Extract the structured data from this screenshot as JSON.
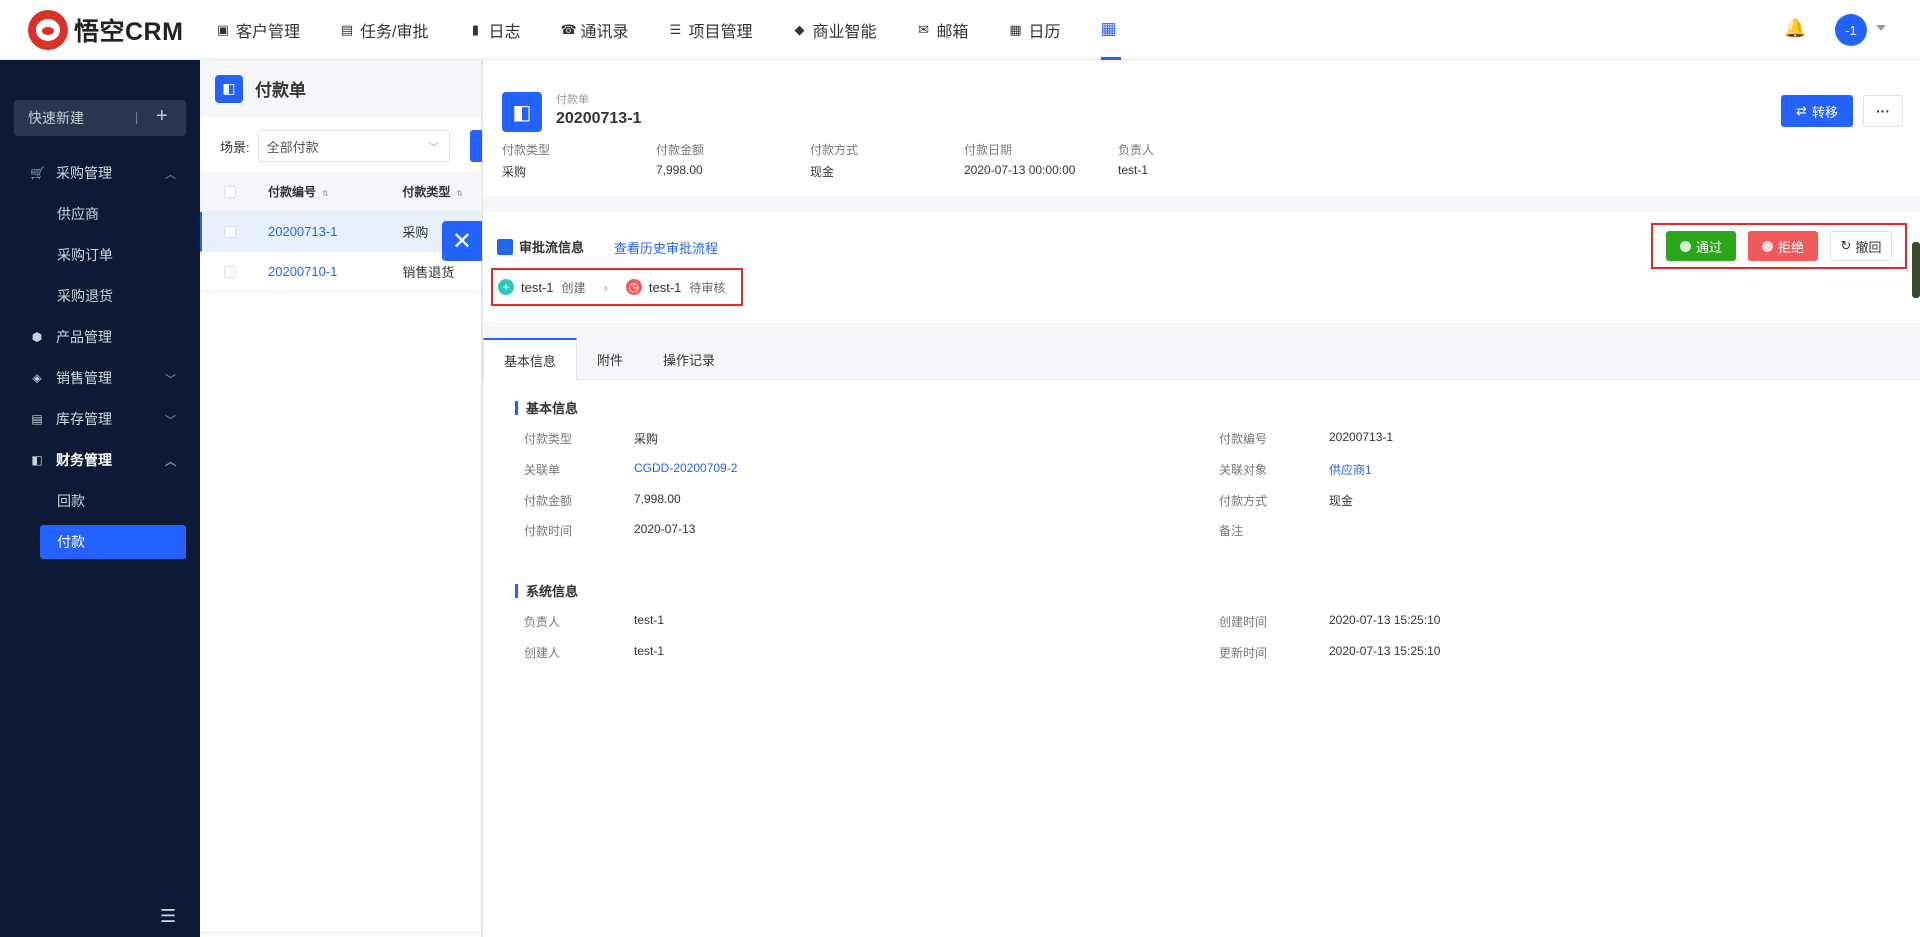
{
  "app": {
    "logo_text": "悟空CRM"
  },
  "nav": {
    "items": [
      {
        "icon": "person-card-icon",
        "glyph": "▣",
        "label": "客户管理"
      },
      {
        "icon": "briefcase-icon",
        "glyph": "▤",
        "label": "任务/审批"
      },
      {
        "icon": "journal-icon",
        "glyph": "▮",
        "label": "日志"
      },
      {
        "icon": "phone-icon",
        "glyph": "☎",
        "label": "通讯录"
      },
      {
        "icon": "list-icon",
        "glyph": "☰",
        "label": "项目管理"
      },
      {
        "icon": "shield-icon",
        "glyph": "◆",
        "label": "商业智能"
      },
      {
        "icon": "mail-icon",
        "glyph": "✉",
        "label": "邮箱"
      },
      {
        "icon": "calendar-icon",
        "glyph": "▦",
        "label": "日历"
      }
    ],
    "apps_glyph": "⋮⋮⋮",
    "avatar_text": "-1"
  },
  "sidebar": {
    "quick_new": "快速新建",
    "quick_new_plus": "+",
    "menu": {
      "purchase": {
        "label": "采购管理",
        "chevron": "^",
        "sub": [
          "供应商",
          "采购订单",
          "采购退货"
        ]
      },
      "product": {
        "label": "产品管理"
      },
      "sales": {
        "label": "销售管理",
        "chevron": "v"
      },
      "stock": {
        "label": "库存管理",
        "chevron": "v"
      },
      "finance": {
        "label": "财务管理",
        "chevron": "^",
        "sub": [
          "回款",
          "付款"
        ]
      }
    }
  },
  "list": {
    "title": "付款单",
    "scene_label": "场景:",
    "scene_value": "全部付款",
    "columns": [
      "付款编号",
      "付款类型"
    ],
    "rows": [
      {
        "no": "20200713-1",
        "type": "采购"
      },
      {
        "no": "20200710-1",
        "type": "销售退货"
      }
    ]
  },
  "detail": {
    "label": "付款单",
    "title": "20200713-1",
    "transfer_label": "转移",
    "more_label": "···",
    "summary": [
      {
        "key": "付款类型",
        "value": "采购"
      },
      {
        "key": "付款金额",
        "value": "7,998.00"
      },
      {
        "key": "付款方式",
        "value": "现金"
      },
      {
        "key": "付款日期",
        "value": "2020-07-13 00:00:00"
      },
      {
        "key": "负责人",
        "value": "test-1"
      }
    ],
    "approval": {
      "title": "审批流信息",
      "history_link": "查看历史审批流程",
      "pass": "通过",
      "reject": "拒绝",
      "recall": "撤回",
      "steps": [
        {
          "name": "test-1",
          "status": "创建"
        },
        {
          "name": "test-1",
          "status": "待审核"
        }
      ]
    },
    "tabs": [
      "基本信息",
      "附件",
      "操作记录"
    ],
    "basic": {
      "title": "基本信息",
      "left": [
        {
          "key": "付款类型",
          "value": "采购"
        },
        {
          "key": "关联单",
          "value": "CGDD-20200709-2"
        },
        {
          "key": "付款金额",
          "value": "7,998.00"
        },
        {
          "key": "付款时间",
          "value": "2020-07-13"
        }
      ],
      "right": [
        {
          "key": "付款编号",
          "value": "20200713-1"
        },
        {
          "key": "关联对象",
          "value": "供应商1"
        },
        {
          "key": "付款方式",
          "value": "现金"
        },
        {
          "key": "备注",
          "value": ""
        }
      ]
    },
    "system": {
      "title": "系统信息",
      "left": [
        {
          "key": "负责人",
          "value": "test-1"
        },
        {
          "key": "创建人",
          "value": "test-1"
        }
      ],
      "right": [
        {
          "key": "创建时间",
          "value": "2020-07-13 15:25:10"
        },
        {
          "key": "更新时间",
          "value": "2020-07-13 15:25:10"
        }
      ]
    }
  },
  "colors": {
    "accent": "#2362fb",
    "sidebar": "#0e1a35",
    "pass": "#2aa51c",
    "reject": "#f05a5a",
    "highlight": "#e02b2b"
  }
}
